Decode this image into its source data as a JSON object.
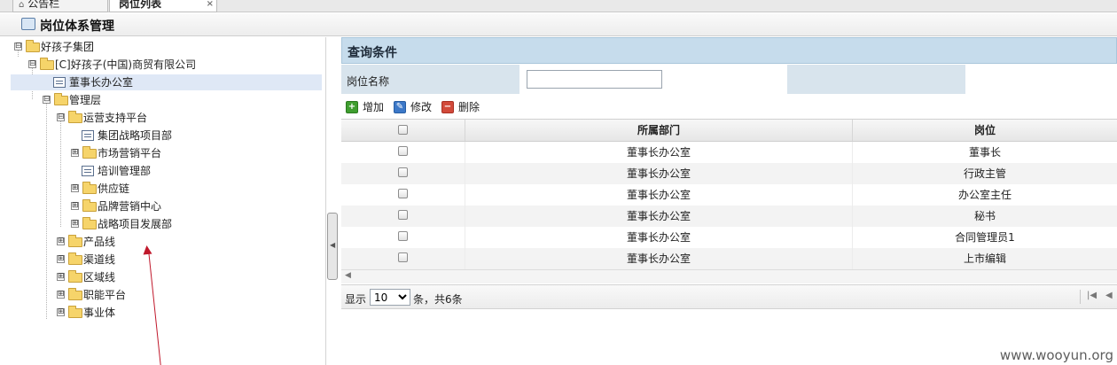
{
  "tabs": [
    {
      "label": "公告栏",
      "icon": "home-icon"
    },
    {
      "label": "岗位列表",
      "close": "×"
    }
  ],
  "page_title": "岗位体系管理",
  "tree": {
    "nodes": [
      {
        "label": "好孩子集团",
        "type": "folder",
        "expander": "⊟"
      },
      {
        "label": "[C]好孩子(中国)商贸有限公司",
        "type": "folder",
        "expander": "⊟"
      },
      {
        "label": "董事长办公室",
        "type": "page",
        "selected": true
      },
      {
        "label": "管理层",
        "type": "folder",
        "expander": "⊟"
      },
      {
        "label": "运营支持平台",
        "type": "folder",
        "expander": "⊟"
      },
      {
        "label": "集团战略项目部",
        "type": "page"
      },
      {
        "label": "市场营销平台",
        "type": "folder",
        "expander": "⊞"
      },
      {
        "label": "培训管理部",
        "type": "page"
      },
      {
        "label": "供应链",
        "type": "folder",
        "expander": "⊞"
      },
      {
        "label": "品牌营销中心",
        "type": "folder",
        "expander": "⊞"
      },
      {
        "label": "战略项目发展部",
        "type": "folder",
        "expander": "⊞"
      },
      {
        "label": "产品线",
        "type": "folder",
        "expander": "⊞"
      },
      {
        "label": "渠道线",
        "type": "folder",
        "expander": "⊞"
      },
      {
        "label": "区域线",
        "type": "folder",
        "expander": "⊞"
      },
      {
        "label": "职能平台",
        "type": "folder",
        "expander": "⊞"
      },
      {
        "label": "事业体",
        "type": "folder",
        "expander": "⊞"
      }
    ]
  },
  "query": {
    "header": "查询条件",
    "field_label": "岗位名称",
    "field_value": "",
    "field_placeholder": ""
  },
  "toolbar": {
    "add": "增加",
    "edit": "修改",
    "delete": "删除"
  },
  "grid": {
    "columns": [
      "所属部门",
      "岗位"
    ],
    "rows": [
      {
        "dept": "董事长办公室",
        "post": "董事长"
      },
      {
        "dept": "董事长办公室",
        "post": "行政主管"
      },
      {
        "dept": "董事长办公室",
        "post": "办公室主任"
      },
      {
        "dept": "董事长办公室",
        "post": "秘书"
      },
      {
        "dept": "董事长办公室",
        "post": "合同管理员1"
      },
      {
        "dept": "董事长办公室",
        "post": "上市编辑"
      }
    ]
  },
  "pager": {
    "show_label": "显示",
    "page_size": "10",
    "summary": "条，共6条"
  },
  "watermark": "www.wooyun.org",
  "colors": {
    "query_header_bg": "#c6dcec",
    "selected_node_bg": "#dfe8f6",
    "arrow": "#c0182b"
  }
}
